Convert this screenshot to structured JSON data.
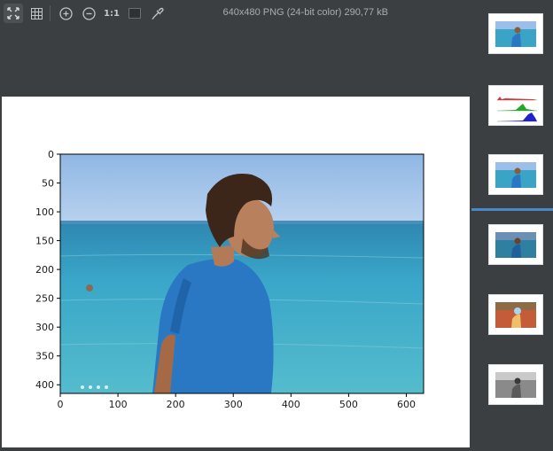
{
  "toolbar": {
    "buttons": [
      {
        "name": "fit-to-window-icon",
        "active": true
      },
      {
        "name": "grid-icon",
        "active": false
      },
      {
        "name": "zoom-in-icon",
        "active": false
      },
      {
        "name": "zoom-out-icon",
        "active": false
      },
      {
        "name": "actual-size-button",
        "active": false
      },
      {
        "name": "background-icon",
        "active": false
      },
      {
        "name": "eyedropper-icon",
        "active": false
      }
    ],
    "actual_size_label": "1:1",
    "file_info": "640x480 PNG (24-bit color) 290,77 kB"
  },
  "plot": {
    "x_ticks": [
      "0",
      "100",
      "200",
      "300",
      "400",
      "500",
      "600"
    ],
    "y_ticks": [
      "0",
      "50",
      "100",
      "150",
      "200",
      "250",
      "300",
      "350",
      "400"
    ]
  },
  "thumbnails": [
    {
      "name": "thumbnail-beach-photo-1",
      "kind": "photo"
    },
    {
      "name": "thumbnail-rgb-histogram",
      "kind": "histogram"
    },
    {
      "name": "thumbnail-beach-photo-2",
      "kind": "photo",
      "selected": true
    },
    {
      "name": "thumbnail-beach-photo-3",
      "kind": "photo"
    },
    {
      "name": "thumbnail-inverted-photo",
      "kind": "inverted"
    },
    {
      "name": "thumbnail-grayscale-photo",
      "kind": "grayscale"
    }
  ],
  "colors": {
    "panel_bg": "#3c3f41",
    "selection_bar": "#4a88c7",
    "sky": "#a9c9ec",
    "sea": "#3aa4c6",
    "shirt": "#2a78c4"
  }
}
